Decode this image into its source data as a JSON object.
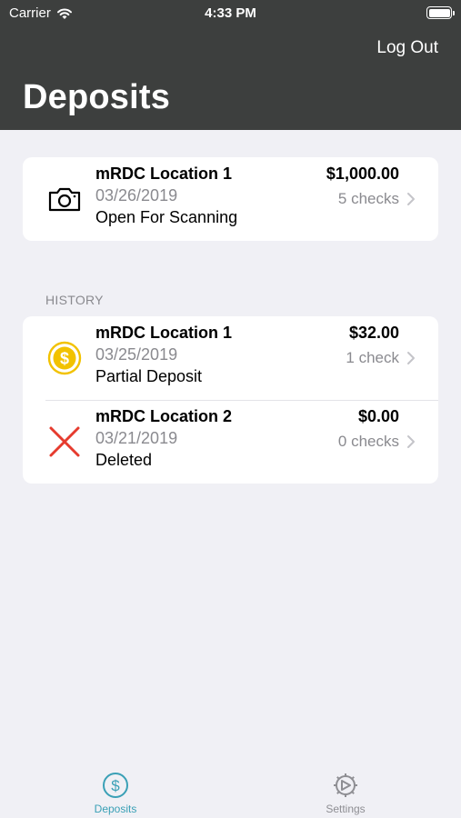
{
  "status_bar": {
    "carrier": "Carrier",
    "time": "4:33 PM"
  },
  "header": {
    "logout_label": "Log Out",
    "title": "Deposits"
  },
  "current_deposit": {
    "name": "mRDC Location 1",
    "date": "03/26/2019",
    "status": "Open For Scanning",
    "amount": "$1,000.00",
    "checks": "5 checks",
    "icon": "camera-icon"
  },
  "history": {
    "label": "HISTORY",
    "items": [
      {
        "name": "mRDC Location 1",
        "date": "03/25/2019",
        "status": "Partial Deposit",
        "amount": "$32.00",
        "checks": "1 check",
        "icon": "dollar-coin-icon",
        "icon_color": "#f2c200"
      },
      {
        "name": "mRDC Location 2",
        "date": "03/21/2019",
        "status": "Deleted",
        "amount": "$0.00",
        "checks": "0 checks",
        "icon": "x-icon",
        "icon_color": "#e63b2e"
      }
    ]
  },
  "tab_bar": {
    "tabs": [
      {
        "label": "Deposits",
        "icon": "dollar-circle-icon",
        "active": true,
        "color": "#3aa0b6"
      },
      {
        "label": "Settings",
        "icon": "gear-icon",
        "active": false,
        "color": "#8e8e93"
      }
    ]
  },
  "colors": {
    "header_bg": "#3d3f3e",
    "page_bg": "#f0f0f5",
    "accent": "#3aa0b6"
  }
}
